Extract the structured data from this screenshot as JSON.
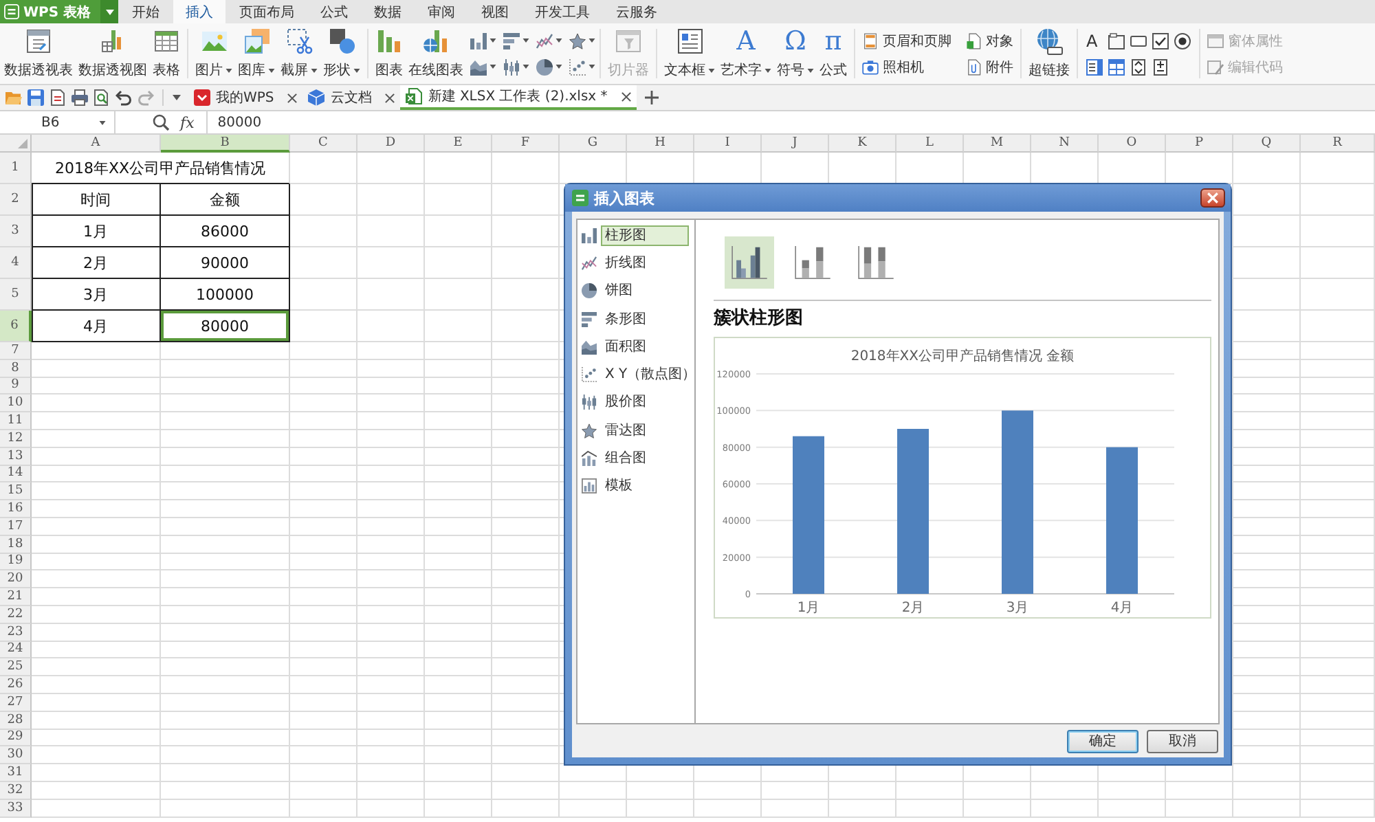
{
  "app_menu": {
    "label": "WPS 表格"
  },
  "menu_tabs": [
    {
      "label": "开始",
      "selected": false
    },
    {
      "label": "插入",
      "selected": true
    },
    {
      "label": "页面布局",
      "selected": false
    },
    {
      "label": "公式",
      "selected": false
    },
    {
      "label": "数据",
      "selected": false
    },
    {
      "label": "审阅",
      "selected": false
    },
    {
      "label": "视图",
      "selected": false
    },
    {
      "label": "开发工具",
      "selected": false
    },
    {
      "label": "云服务",
      "selected": false
    }
  ],
  "ribbon": [
    {
      "kind": "large",
      "items": [
        {
          "label": "数据透视表",
          "dropdown": false,
          "disabled": false
        },
        {
          "label": "数据透视图",
          "dropdown": false,
          "disabled": false
        },
        {
          "label": "表格",
          "dropdown": false,
          "disabled": false
        }
      ]
    },
    {
      "kind": "large",
      "items": [
        {
          "label": "图片",
          "dropdown": true,
          "disabled": false
        },
        {
          "label": "图库",
          "dropdown": true,
          "disabled": false
        },
        {
          "label": "截屏",
          "dropdown": true,
          "disabled": false
        },
        {
          "label": "形状",
          "dropdown": true,
          "disabled": false
        }
      ]
    },
    {
      "kind": "large",
      "items": [
        {
          "label": "图表",
          "dropdown": false,
          "disabled": false
        },
        {
          "label": "在线图表",
          "dropdown": false,
          "disabled": false
        }
      ]
    },
    {
      "kind": "chart-palette",
      "items": [
        {
          "dropdown": true
        },
        {
          "dropdown": true
        },
        {
          "dropdown": true
        },
        {
          "dropdown": true
        },
        {
          "dropdown": true
        },
        {
          "dropdown": true
        },
        {
          "dropdown": true
        },
        {
          "dropdown": true
        }
      ]
    },
    {
      "kind": "large",
      "items": [
        {
          "label": "切片器",
          "dropdown": false,
          "disabled": true
        }
      ]
    },
    {
      "kind": "large",
      "items": [
        {
          "label": "文本框",
          "dropdown": true,
          "disabled": false
        },
        {
          "label": "艺术字",
          "dropdown": true,
          "disabled": false,
          "glyph": "A"
        },
        {
          "label": "符号",
          "dropdown": true,
          "disabled": false,
          "glyph": "Ω"
        },
        {
          "label": "公式",
          "dropdown": false,
          "disabled": false,
          "glyph": "π"
        }
      ]
    },
    {
      "kind": "small",
      "items": [
        {
          "label": "页眉和页脚",
          "disabled": false
        },
        {
          "label": "对象",
          "disabled": false
        },
        {
          "label": "照相机",
          "disabled": false
        },
        {
          "label": "附件",
          "disabled": false
        }
      ]
    },
    {
      "kind": "large",
      "items": [
        {
          "label": "超链接",
          "dropdown": false,
          "disabled": false
        }
      ]
    },
    {
      "kind": "form-controls",
      "glyph": "A"
    },
    {
      "kind": "small",
      "items": [
        {
          "label": "窗体属性",
          "disabled": true
        },
        {
          "label": "编辑代码",
          "disabled": true
        }
      ]
    }
  ],
  "doc_tabs": [
    {
      "label": "我的WPS",
      "selected": false
    },
    {
      "label": "云文档",
      "selected": false
    },
    {
      "label": "新建 XLSX 工作表 (2).xlsx *",
      "selected": true
    }
  ],
  "formula_bar": {
    "cell_ref": "B6",
    "fx": "fx",
    "value": "80000"
  },
  "sheet": {
    "columns": [
      {
        "label": "A",
        "selected": false
      },
      {
        "label": "B",
        "selected": true
      },
      {
        "label": "C",
        "selected": false
      },
      {
        "label": "D",
        "selected": false
      },
      {
        "label": "E",
        "selected": false
      },
      {
        "label": "F",
        "selected": false
      },
      {
        "label": "G",
        "selected": false
      },
      {
        "label": "H",
        "selected": false
      },
      {
        "label": "I",
        "selected": false
      },
      {
        "label": "J",
        "selected": false
      },
      {
        "label": "K",
        "selected": false
      },
      {
        "label": "L",
        "selected": false
      },
      {
        "label": "M",
        "selected": false
      },
      {
        "label": "N",
        "selected": false
      },
      {
        "label": "O",
        "selected": false
      },
      {
        "label": "P",
        "selected": false
      },
      {
        "label": "Q",
        "selected": false
      },
      {
        "label": "R",
        "selected": false
      }
    ],
    "rows": [
      {
        "label": "1",
        "selected": false
      },
      {
        "label": "2",
        "selected": false
      },
      {
        "label": "3",
        "selected": false
      },
      {
        "label": "4",
        "selected": false
      },
      {
        "label": "5",
        "selected": false
      },
      {
        "label": "6",
        "selected": true
      },
      {
        "label": "7",
        "selected": false
      },
      {
        "label": "8",
        "selected": false
      },
      {
        "label": "9",
        "selected": false
      },
      {
        "label": "10",
        "selected": false
      },
      {
        "label": "11",
        "selected": false
      },
      {
        "label": "12",
        "selected": false
      },
      {
        "label": "13",
        "selected": false
      },
      {
        "label": "14",
        "selected": false
      },
      {
        "label": "15",
        "selected": false
      },
      {
        "label": "16",
        "selected": false
      },
      {
        "label": "17",
        "selected": false
      },
      {
        "label": "18",
        "selected": false
      },
      {
        "label": "19",
        "selected": false
      },
      {
        "label": "20",
        "selected": false
      },
      {
        "label": "21",
        "selected": false
      },
      {
        "label": "22",
        "selected": false
      },
      {
        "label": "23",
        "selected": false
      },
      {
        "label": "24",
        "selected": false
      },
      {
        "label": "25",
        "selected": false
      },
      {
        "label": "26",
        "selected": false
      },
      {
        "label": "27",
        "selected": false
      },
      {
        "label": "28",
        "selected": false
      },
      {
        "label": "29",
        "selected": false
      },
      {
        "label": "30",
        "selected": false
      },
      {
        "label": "31",
        "selected": false
      },
      {
        "label": "32",
        "selected": false
      },
      {
        "label": "33",
        "selected": false
      }
    ],
    "title": "2018年XX公司甲产品销售情况",
    "table": [
      [
        {
          "text": "时间",
          "selected": false
        },
        {
          "text": "金额",
          "selected": false
        }
      ],
      [
        {
          "text": "1月",
          "selected": false
        },
        {
          "text": "86000",
          "selected": false
        }
      ],
      [
        {
          "text": "2月",
          "selected": false
        },
        {
          "text": "90000",
          "selected": false
        }
      ],
      [
        {
          "text": "3月",
          "selected": false
        },
        {
          "text": "100000",
          "selected": false
        }
      ],
      [
        {
          "text": "4月",
          "selected": false
        },
        {
          "text": "80000",
          "selected": true
        }
      ]
    ]
  },
  "dialog": {
    "title": "插入图表",
    "chart_types": [
      {
        "label": "柱形图",
        "selected": true
      },
      {
        "label": "折线图",
        "selected": false
      },
      {
        "label": "饼图",
        "selected": false
      },
      {
        "label": "条形图",
        "selected": false
      },
      {
        "label": "面积图",
        "selected": false
      },
      {
        "label": "X Y（散点图）",
        "selected": false
      },
      {
        "label": "股价图",
        "selected": false
      },
      {
        "label": "雷达图",
        "selected": false
      },
      {
        "label": "组合图",
        "selected": false
      },
      {
        "label": "模板",
        "selected": false
      }
    ],
    "subtypes": [
      {
        "selected": true
      },
      {
        "selected": false
      },
      {
        "selected": false
      }
    ],
    "subtype_title": "簇状柱形图",
    "preview": {
      "chart_data": {
        "type": "bar",
        "title": "2018年XX公司甲产品销售情况 金额",
        "categories": [
          "1月",
          "2月",
          "3月",
          "4月"
        ],
        "series": [
          {
            "color": "#4f81bd",
            "values": [
              86000,
              90000,
              100000,
              80000
            ]
          }
        ],
        "ylim": [
          0,
          120000
        ],
        "yticks": [
          0,
          20000,
          40000,
          60000,
          80000,
          100000,
          120000
        ],
        "grid": true
      }
    },
    "buttons": [
      {
        "label": "确定",
        "kind": "primary"
      },
      {
        "label": "取消",
        "kind": "secondary"
      }
    ]
  }
}
